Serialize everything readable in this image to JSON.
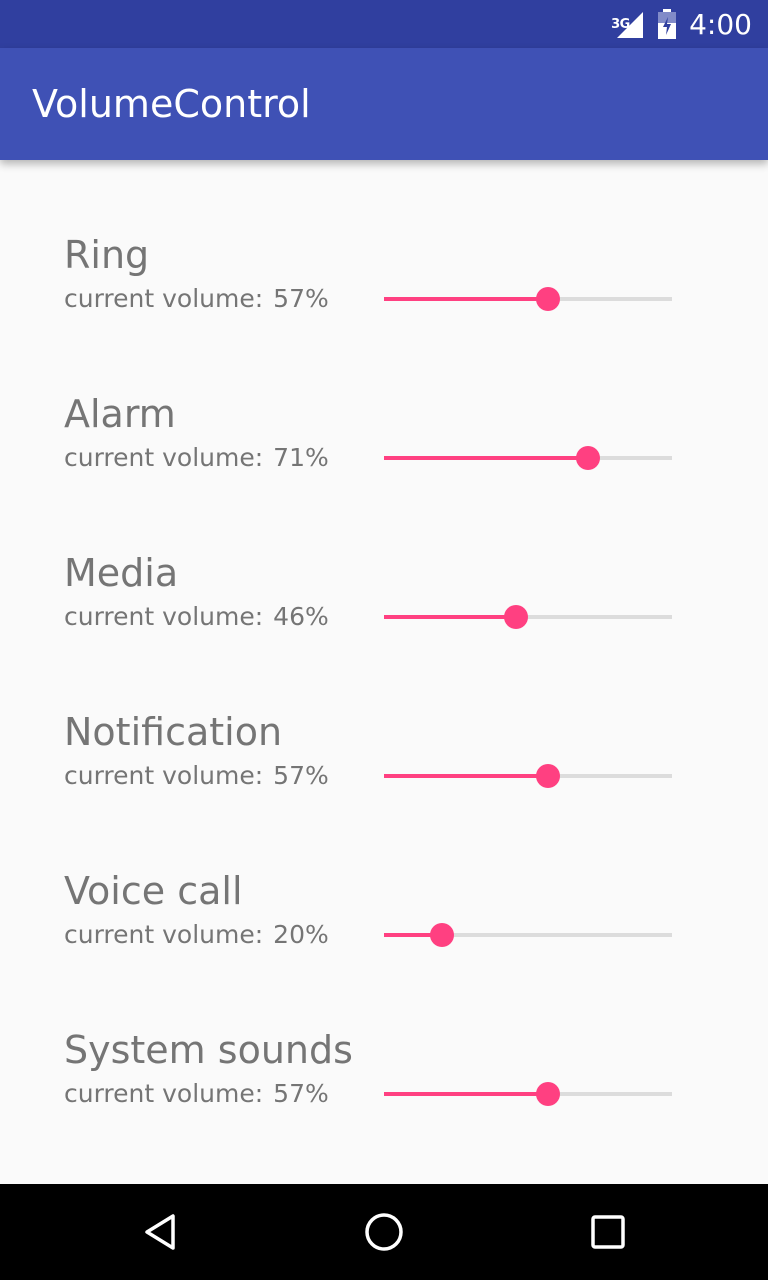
{
  "status_bar": {
    "network": "3G",
    "time": "4:00",
    "icons": [
      "signal-icon",
      "battery-icon"
    ]
  },
  "app_bar": {
    "title": "VolumeControl"
  },
  "volumes": [
    {
      "name": "Ring",
      "caption": "current volume:",
      "percent_text": "57%",
      "level": 0.57
    },
    {
      "name": "Alarm",
      "caption": "current volume:",
      "percent_text": "71%",
      "level": 0.71
    },
    {
      "name": "Media",
      "caption": "current volume:",
      "percent_text": "46%",
      "level": 0.46
    },
    {
      "name": "Notification",
      "caption": "current volume:",
      "percent_text": "57%",
      "level": 0.57
    },
    {
      "name": "Voice call",
      "caption": "current volume:",
      "percent_text": "20%",
      "level": 0.2
    },
    {
      "name": "System sounds",
      "caption": "current volume:",
      "percent_text": "57%",
      "level": 0.57
    }
  ],
  "nav_bar": {
    "icons": [
      "back-icon",
      "home-icon",
      "recents-icon"
    ]
  },
  "colors": {
    "status_bar": "#303f9f",
    "app_bar": "#3f51b5",
    "accent": "#ff4081",
    "text_secondary": "#757575",
    "track": "#dcdcdc"
  }
}
